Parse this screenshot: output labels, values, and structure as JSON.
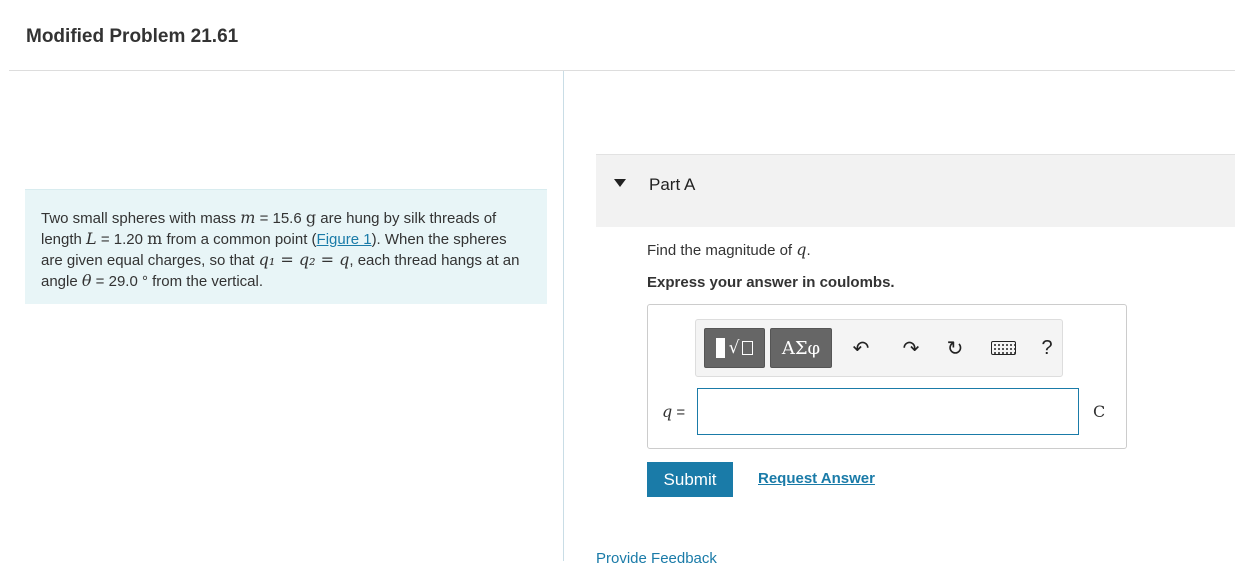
{
  "page": {
    "title": "Modified Problem 21.61"
  },
  "problem": {
    "t1": "Two small spheres with mass ",
    "m_sym": "m",
    "t2": " = 15.6 ",
    "g_unit": "g",
    "t3": " are hung by silk threads of length ",
    "L_sym": "L",
    "t4": " = 1.20 ",
    "m_unit": "m",
    "t5": " from a common point (",
    "figure_link": "Figure 1",
    "t6": "). When the spheres are given equal charges, so that ",
    "q_eq": "q₁ = q₂ = q",
    "t7": ", each thread hangs at an angle ",
    "theta_sym": "θ",
    "t8": " = 29.0 °  from the vertical."
  },
  "part": {
    "label": "Part A",
    "question_prefix": "Find the magnitude of ",
    "question_var": "q",
    "question_suffix": ".",
    "instruction": "Express your answer in coulombs."
  },
  "toolbar": {
    "templates_radical": "√",
    "greek_label": "ΑΣφ",
    "undo_glyph": "↶",
    "redo_glyph": "↷",
    "reset_glyph": "↻",
    "help_label": "?",
    "icons": [
      "templates-icon",
      "greek-symbols-icon",
      "undo-icon",
      "redo-icon",
      "reset-icon",
      "keyboard-icon",
      "help-icon"
    ]
  },
  "answer": {
    "var_label": "q",
    "eq_sign": " =",
    "value": "",
    "unit": "C"
  },
  "actions": {
    "submit_label": "Submit",
    "request_label": "Request Answer",
    "feedback_label": "Provide Feedback"
  },
  "colors": {
    "accent": "#1a7ba8",
    "problem_bg": "#e8f5f7",
    "part_header_bg": "#f2f2f2",
    "toolbar_button": "#666666"
  }
}
